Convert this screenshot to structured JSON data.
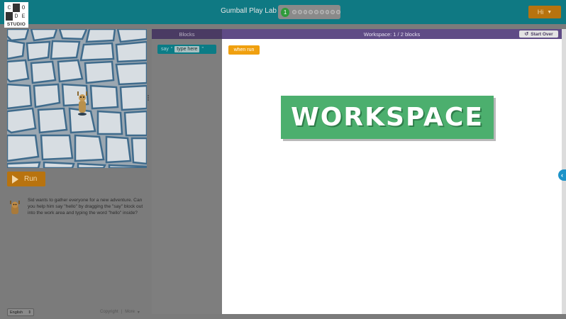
{
  "header": {
    "logo": {
      "letters": [
        "C",
        "O",
        "D",
        "E"
      ],
      "studio": "STUDIO"
    },
    "level_title": "Gumball Play Lab",
    "progress": {
      "current": "1",
      "total_puzzles": 10
    },
    "user_button": "Hi"
  },
  "visualization": {
    "run_label": "Run"
  },
  "instructions": {
    "text": "Sid wants to gather everyone for a new adventure. Can you help him say \"hello\" by dragging the \"say\" block out into the work area and typing the word \"hello\" inside?"
  },
  "footer": {
    "language": "English",
    "copyright": "Copyright",
    "separator": "|",
    "more": "More"
  },
  "toolbox": {
    "header": "Blocks",
    "say_block": {
      "keyword": "say",
      "open_quote": "“",
      "placeholder": "type here",
      "close_quote": "”"
    }
  },
  "workspace": {
    "header": "Workspace: 1 / 2 blocks",
    "start_over": "Start Over",
    "when_run": "when run",
    "banner": "WORKSPACE"
  },
  "colors": {
    "header_bg": "#0f7983",
    "accent_orange": "#b8730f",
    "workspace_purple": "#5f4b86",
    "banner_green": "#4caf6e",
    "event_block": "#f0a00f",
    "say_block": "#0b7c86"
  },
  "icons": {
    "run": "play-triangle-icon",
    "start_over": "reset-arrow-icon",
    "collapse": "chevron-left-icon",
    "dropdown": "caret-down-icon"
  }
}
